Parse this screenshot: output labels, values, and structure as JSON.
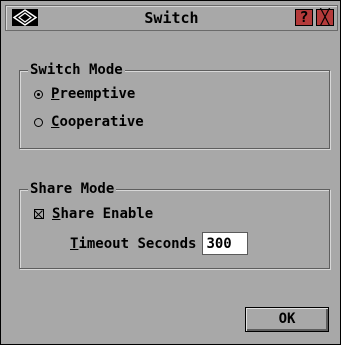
{
  "window": {
    "title": "Switch",
    "help_label": "?",
    "close_label": "╳"
  },
  "switch_mode": {
    "legend": "Switch Mode",
    "options": [
      {
        "key": "P",
        "rest": "reemptive",
        "selected": true
      },
      {
        "key": "C",
        "rest": "ooperative",
        "selected": false
      }
    ]
  },
  "share_mode": {
    "legend": "Share Mode",
    "share_enable": {
      "key": "S",
      "rest": "hare Enable",
      "checked": true
    },
    "timeout": {
      "key": "T",
      "rest": "imeout Seconds",
      "value": "300"
    }
  },
  "ok_label": "OK"
}
